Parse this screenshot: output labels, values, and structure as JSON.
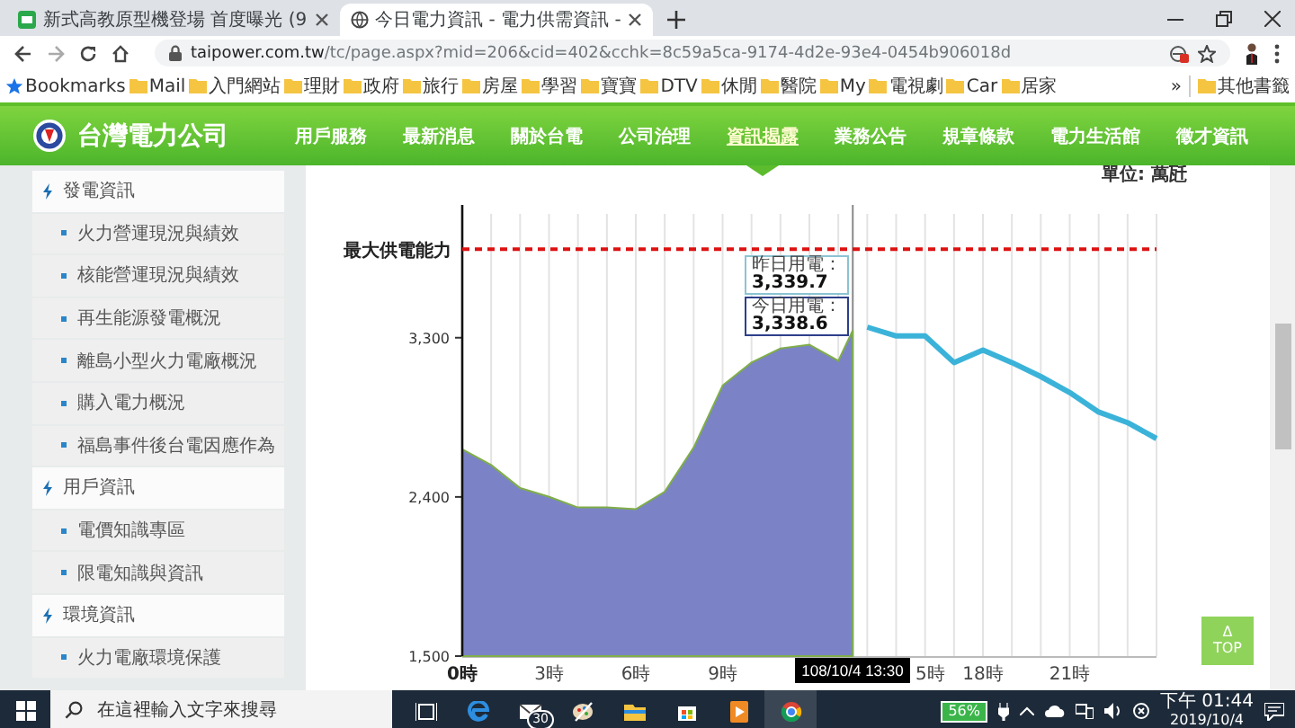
{
  "browser": {
    "tabs": [
      {
        "title": "新式高教原型機登場 首度曝光 (9",
        "selected": false
      },
      {
        "title": "今日電力資訊 - 電力供需資訊 -",
        "selected": true
      }
    ],
    "url": {
      "host": "taipower.com.tw",
      "path": "/tc/page.aspx?mid=206&cid=402&cchk=8c59a5ca-9174-4d2e-93e4-0454b906018d"
    },
    "bookmarks": [
      {
        "label": "Bookmarks",
        "kind": "star"
      },
      {
        "label": "Mail",
        "kind": "folder"
      },
      {
        "label": "入門網站",
        "kind": "folder"
      },
      {
        "label": "理財",
        "kind": "folder"
      },
      {
        "label": "政府",
        "kind": "folder"
      },
      {
        "label": "旅行",
        "kind": "folder"
      },
      {
        "label": "房屋",
        "kind": "folder"
      },
      {
        "label": "學習",
        "kind": "folder"
      },
      {
        "label": "寶寶",
        "kind": "folder"
      },
      {
        "label": "DTV",
        "kind": "folder"
      },
      {
        "label": "休閒",
        "kind": "folder"
      },
      {
        "label": "醫院",
        "kind": "folder"
      },
      {
        "label": "My",
        "kind": "folder"
      },
      {
        "label": "電視劇",
        "kind": "folder"
      },
      {
        "label": "Car",
        "kind": "folder"
      },
      {
        "label": "居家",
        "kind": "folder"
      }
    ],
    "overflow": "»",
    "other_bookmarks": "其他書籤"
  },
  "site": {
    "logo_text": "台灣電力公司",
    "nav": [
      {
        "label": "用戶服務",
        "selected": false
      },
      {
        "label": "最新消息",
        "selected": false
      },
      {
        "label": "關於台電",
        "selected": false
      },
      {
        "label": "公司治理",
        "selected": false
      },
      {
        "label": "資訊揭露",
        "selected": true
      },
      {
        "label": "業務公告",
        "selected": false
      },
      {
        "label": "規章條款",
        "selected": false
      },
      {
        "label": "電力生活館",
        "selected": false
      },
      {
        "label": "徵才資訊",
        "selected": false
      }
    ],
    "sidebar": {
      "items": [
        {
          "label": "發電資訊",
          "children": [
            {
              "label": "火力營運現況與績效"
            },
            {
              "label": "核能營運現況與績效"
            },
            {
              "label": "再生能源發電概況"
            },
            {
              "label": "離島小型火力電廠概況"
            },
            {
              "label": "購入電力概況"
            },
            {
              "label": "福島事件後台電因應作為"
            }
          ]
        },
        {
          "label": "用戶資訊",
          "children": [
            {
              "label": "電價知識專區"
            },
            {
              "label": "限電知識與資訊"
            }
          ]
        },
        {
          "label": "環境資訊",
          "children": [
            {
              "label": "火力電廠環境保護"
            }
          ]
        }
      ]
    },
    "chart": {
      "chart_data": {
        "type": "area",
        "ylabel": "單位: 萬瓩",
        "x": [
          0,
          1,
          2,
          3,
          4,
          5,
          6,
          7,
          8,
          9,
          10,
          11,
          12,
          13,
          13.5,
          14,
          15,
          16,
          17,
          18,
          19,
          20,
          21,
          22,
          23,
          24
        ],
        "series": [
          {
            "color": "#7b83c6",
            "values": [
              2670,
              2580,
              2450,
              2400,
              2340,
              2340,
              2330,
              2430,
              2680,
              3030,
              3160,
              3240,
              3260,
              3170,
              3340,
              null,
              null,
              null,
              null,
              null,
              null,
              null,
              null,
              null,
              null,
              null
            ]
          },
          {
            "type": "line",
            "color": "#3bb3d9",
            "values": [
              null,
              null,
              null,
              null,
              null,
              null,
              null,
              null,
              null,
              null,
              null,
              null,
              null,
              null,
              null,
              3360,
              3310,
              3310,
              3160,
              3230,
              3160,
              3080,
              2990,
              2880,
              2820,
              2730
            ]
          }
        ],
        "xlim": [
          0,
          24
        ],
        "ylim": [
          1500,
          4000
        ],
        "xticks": [
          {
            "value": 0,
            "label": "0時"
          },
          {
            "value": 3,
            "label": "3時"
          },
          {
            "value": 6,
            "label": "6時"
          },
          {
            "value": 9,
            "label": "9時"
          },
          {
            "value": 18,
            "label": "18時"
          },
          {
            "value": 21,
            "label": "21時"
          }
        ],
        "yticks": [
          {
            "value": 1500,
            "label": "1,500"
          },
          {
            "value": 2400,
            "label": "2,400"
          },
          {
            "value": 3300,
            "label": "3,300"
          }
        ],
        "grid": true,
        "ref_lines": [
          {
            "axis": "y",
            "value": 3800,
            "label": "最大供電能力",
            "color": "#dd1111"
          },
          {
            "axis": "x",
            "value": 13.5,
            "color": "#888888"
          }
        ]
      },
      "covered_tick": "5時",
      "tooltips": [
        {
          "label": "昨日用電：",
          "value": "3,339.7",
          "color": "#8cc3d3"
        },
        {
          "label": "今日用電：",
          "value": "3,338.6",
          "color": "#2d3f8a"
        }
      ],
      "time_label": "108/10/4 13:30"
    },
    "top_button": {
      "icon": "Δ",
      "label": "TOP"
    }
  },
  "taskbar": {
    "search": {
      "placeholder": "在這裡輸入文字來搜尋"
    },
    "mail_badge": "30",
    "battery": "56%",
    "time": "下午 01:44",
    "date": "2019/10/4"
  }
}
